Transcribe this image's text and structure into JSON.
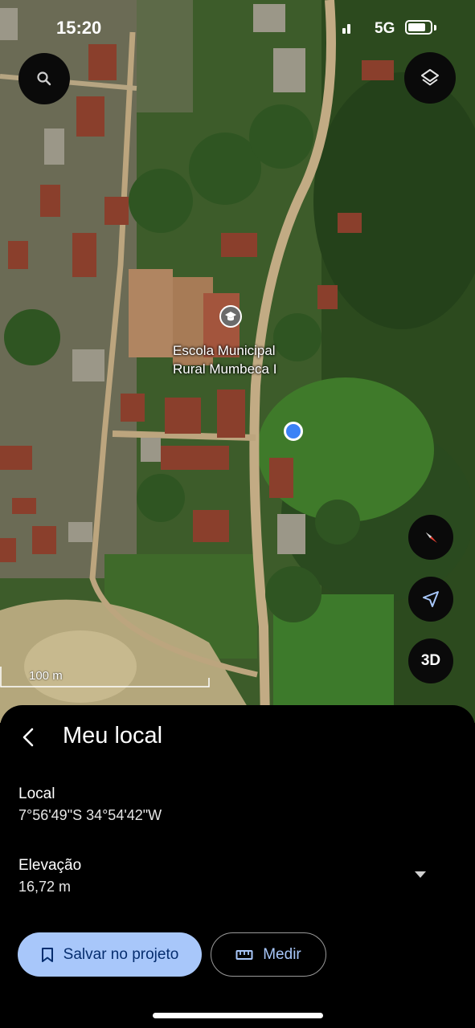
{
  "status_bar": {
    "time": "15:20",
    "network": "5G",
    "battery_level": 0.8
  },
  "map": {
    "poi": {
      "name_line1": "Escola Municipal",
      "name_line2": "Rural Mumbeca I",
      "icon": "school-icon"
    },
    "scale_label": "100 m",
    "controls": {
      "search_icon": "search-icon",
      "layers_icon": "layers-icon",
      "compass_icon": "compass-icon",
      "my_location_icon": "navigation-arrow-icon",
      "btn_3d": "3D"
    }
  },
  "sheet": {
    "title": "Meu local",
    "location_label": "Local",
    "location_value": "7°56'49\"S 34°54'42\"W",
    "elevation_label": "Elevação",
    "elevation_value": "16,72 m",
    "save_button": "Salvar no projeto",
    "measure_button": "Medir"
  },
  "colors": {
    "accent": "#a8c7fa",
    "location_dot": "#3b82f6",
    "sheet_bg": "#000000"
  }
}
